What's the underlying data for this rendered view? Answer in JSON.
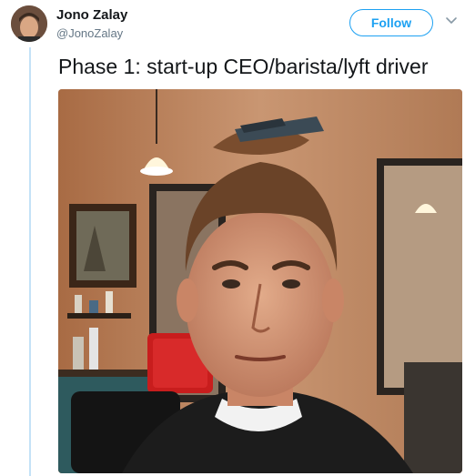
{
  "author": {
    "name": "Jono Zalay",
    "handle": "@JonoZalay"
  },
  "actions": {
    "follow_label": "Follow",
    "menu_icon": "chevron-down-icon"
  },
  "tweet": {
    "text": "Phase 1: start-up CEO/barista/lyft driver"
  },
  "colors": {
    "accent": "#1da1f2",
    "name": "#14171a",
    "handle": "#657786",
    "thread_line": "#c4e2f7"
  }
}
